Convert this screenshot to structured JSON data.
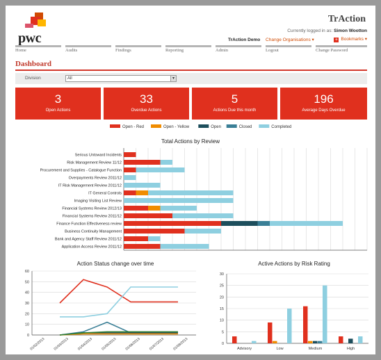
{
  "brand": {
    "logo_text": "pwc",
    "app_title": "TrAction"
  },
  "user": {
    "logged_in_prefix": "Currently logged in as:",
    "name": "Simon Wootton",
    "organisation": "TrAction Demo",
    "change_org_label": "Change Organisations ▾",
    "bookmarks_label": "Bookmarks ▾"
  },
  "nav": [
    "Home",
    "Audits",
    "Findings",
    "Reporting",
    "Admin",
    "Logout",
    "Change Password"
  ],
  "page": {
    "title": "Dashboard"
  },
  "filter": {
    "label": "Division",
    "value": "All"
  },
  "kpis": [
    {
      "value": "3",
      "label": "Open Actions"
    },
    {
      "value": "33",
      "label": "Overdue Actions"
    },
    {
      "value": "5",
      "label": "Actions Due this month"
    },
    {
      "value": "196",
      "label": "Average Days Overdue"
    }
  ],
  "colors": {
    "red": "#e0301e",
    "yellow": "#f08c00",
    "open": "#1d4e5c",
    "closed": "#3a7f96",
    "completed": "#8ecfe0",
    "accent": "#d04a02"
  },
  "chart_data": [
    {
      "type": "bar",
      "orientation": "horizontal",
      "stacked": true,
      "title": "Total Actions by Review",
      "legend": [
        "Open - Red",
        "Open - Yellow",
        "Open",
        "Closed",
        "Completed"
      ],
      "legend_placement": "top",
      "xlim": [
        0,
        20
      ],
      "xticks": [
        0,
        1,
        2,
        3,
        4,
        5,
        6,
        7,
        8,
        9,
        10,
        11,
        12,
        13,
        14,
        15,
        16,
        17,
        18,
        19,
        20
      ],
      "grid": true,
      "categories": [
        "Serious Untoward Incidents",
        "Risk Management Review 11/12",
        "Procurement and Supplies - Catalogue Function",
        "Overpayments Review 2011/12",
        "IT Risk Management Review 2011/12",
        "IT General Controls",
        "Imaging Visiting List Review",
        "Financial Systems Review 2012/13",
        "Financial Systems Review 2011/12",
        "Finance Function Effectiveness review",
        "Business Continuity Management",
        "Bank and Agency Staff Review 2011/12",
        "Application Access Review 2011/12"
      ],
      "series": [
        {
          "name": "Open - Red",
          "values": [
            1,
            3,
            1,
            0,
            0,
            1,
            0,
            2,
            4,
            8,
            5,
            2,
            3
          ]
        },
        {
          "name": "Open - Yellow",
          "values": [
            0,
            0,
            0,
            0,
            0,
            1,
            0,
            1,
            0,
            0,
            0,
            0,
            0
          ]
        },
        {
          "name": "Open",
          "values": [
            0,
            0,
            0,
            0,
            0,
            0,
            0,
            0,
            0,
            3,
            0,
            0,
            0
          ]
        },
        {
          "name": "Closed",
          "values": [
            0,
            0,
            0,
            0,
            0,
            0,
            0,
            0,
            0,
            1,
            0,
            0,
            0
          ]
        },
        {
          "name": "Completed",
          "values": [
            0,
            1,
            4,
            1,
            3,
            7,
            9,
            3,
            5,
            6,
            3,
            1,
            4
          ]
        }
      ]
    },
    {
      "type": "line",
      "title": "Action Status change over time",
      "x": [
        "01/02/2013",
        "01/03/2013",
        "01/04/2013",
        "01/05/2013",
        "01/06/2013",
        "01/07/2013",
        "01/08/2013"
      ],
      "ylim": [
        0,
        60
      ],
      "yticks": [
        0,
        10,
        20,
        30,
        40,
        50,
        60
      ],
      "grid": true,
      "series": [
        {
          "color": "#e0301e",
          "values": [
            30,
            52,
            45,
            31,
            31,
            31
          ]
        },
        {
          "color": "#8ecfe0",
          "values": [
            17,
            17,
            20,
            45,
            45,
            45
          ]
        },
        {
          "color": "#3a7f96",
          "values": [
            0,
            3,
            12,
            2,
            2,
            2
          ]
        },
        {
          "color": "#1d4e5c",
          "values": [
            0,
            2,
            2,
            2,
            2,
            2
          ]
        },
        {
          "color": "#f08c00",
          "values": [
            0,
            1,
            1,
            1,
            1,
            1
          ]
        },
        {
          "color": "#2e7d32",
          "values": [
            0,
            2,
            3,
            3,
            3,
            3
          ]
        }
      ]
    },
    {
      "type": "bar",
      "title": "Active Actions by Risk Rating",
      "categories": [
        "Advisory",
        "Low",
        "Medium",
        "High"
      ],
      "ylim": [
        0,
        30
      ],
      "yticks": [
        0,
        5,
        10,
        15,
        20,
        25,
        30
      ],
      "grid": true,
      "series": [
        {
          "name": "Open - Red",
          "values": [
            3,
            9,
            16,
            3
          ]
        },
        {
          "name": "Open - Yellow",
          "values": [
            0,
            1,
            1,
            0
          ]
        },
        {
          "name": "Open",
          "values": [
            0,
            0,
            1,
            2
          ]
        },
        {
          "name": "Closed",
          "values": [
            0,
            0,
            1,
            0
          ]
        },
        {
          "name": "Completed",
          "values": [
            1,
            15,
            25,
            3
          ]
        }
      ]
    }
  ]
}
